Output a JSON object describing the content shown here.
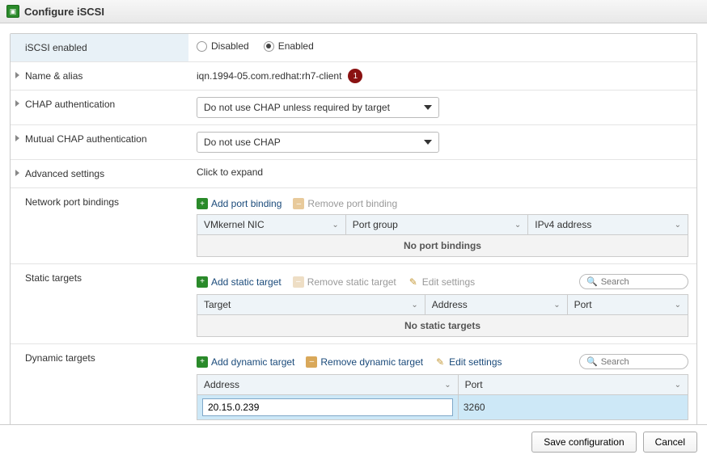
{
  "window": {
    "title": "Configure iSCSI"
  },
  "iscsi_enabled": {
    "label": "iSCSI enabled",
    "disabled_label": "Disabled",
    "enabled_label": "Enabled",
    "selected": "enabled"
  },
  "name_alias": {
    "label": "Name & alias",
    "value": "iqn.1994-05.com.redhat:rh7-client",
    "badge": "1"
  },
  "chap_auth": {
    "label": "CHAP authentication",
    "value": "Do not use CHAP unless required by target"
  },
  "mutual_chap": {
    "label": "Mutual CHAP authentication",
    "value": "Do not use CHAP"
  },
  "advanced": {
    "label": "Advanced settings",
    "value": "Click to expand"
  },
  "port_bindings": {
    "label": "Network port bindings",
    "add_label": "Add port binding",
    "remove_label": "Remove port binding",
    "columns": {
      "nic": "VMkernel NIC",
      "port_group": "Port group",
      "ipv4": "IPv4 address"
    },
    "empty": "No port bindings"
  },
  "static_targets": {
    "label": "Static targets",
    "add_label": "Add static target",
    "remove_label": "Remove static target",
    "edit_label": "Edit settings",
    "search_placeholder": "Search",
    "columns": {
      "target": "Target",
      "address": "Address",
      "port": "Port"
    },
    "empty": "No static targets"
  },
  "dynamic_targets": {
    "label": "Dynamic targets",
    "add_label": "Add dynamic target",
    "remove_label": "Remove dynamic target",
    "edit_label": "Edit settings",
    "search_placeholder": "Search",
    "columns": {
      "address": "Address",
      "port": "Port"
    },
    "row": {
      "address": "20.15.0.239",
      "port": "3260"
    }
  },
  "footer": {
    "save": "Save configuration",
    "cancel": "Cancel"
  }
}
